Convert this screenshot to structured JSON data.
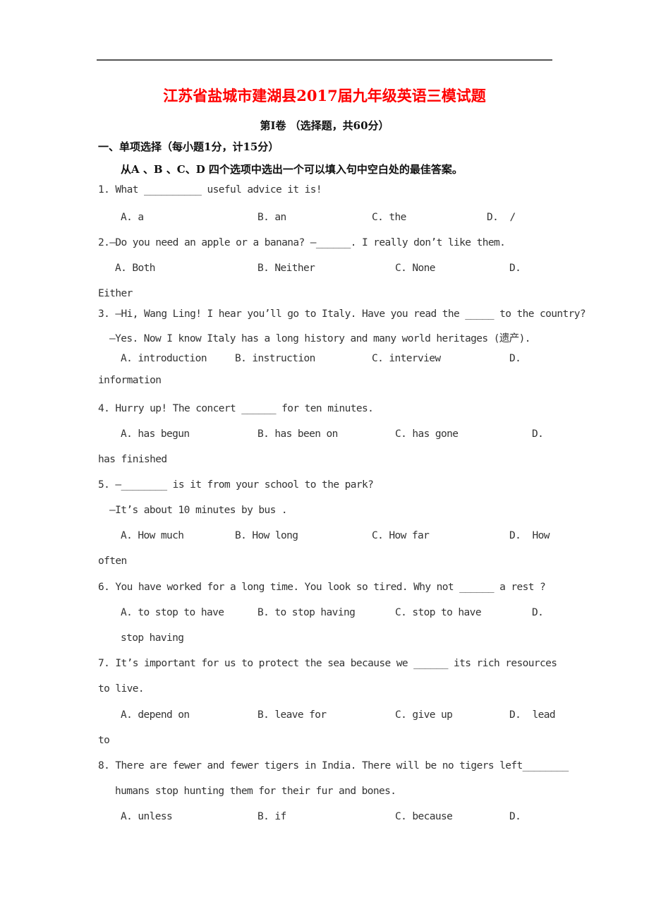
{
  "document": {
    "title": "江苏省盐城市建湖县2017届九年级英语三模试题",
    "part_heading": "第Ⅰ卷 （选择题，共60分）",
    "section_heading": "一、单项选择（每小题1分，计15分）",
    "instructions": "从A 、B 、C、D 四个选项中选出一个可以填入句中空白处的最佳答案。",
    "questions": [
      {
        "lines": [
          "1. What __________ useful advice it is!"
        ],
        "options": [
          "A. a",
          "B. an",
          "C. the",
          "D.  /"
        ],
        "overflow": ""
      },
      {
        "lines": [
          "2.—Do you need an apple or a banana? —______. I really don’t like them."
        ],
        "options": [
          "A. Both",
          "B. Neither",
          "C. None",
          "D."
        ],
        "overflow": "Either"
      },
      {
        "lines": [
          "3. —Hi, Wang Ling! I hear you’ll go to Italy. Have you read the _____ to the country?",
          "—Yes. Now I know Italy has a long history and many world heritages (遗产)."
        ],
        "options": [
          "A. introduction",
          "B. instruction",
          "C. interview",
          "D."
        ],
        "overflow": "information"
      },
      {
        "lines": [
          "4. Hurry up! The concert ______ for ten minutes."
        ],
        "options": [
          "A. has begun",
          "B. has been on",
          "C. has gone",
          "D."
        ],
        "overflow": "has finished"
      },
      {
        "lines": [
          "5. —________ is it from your school to the park?",
          "—It’s about 10 minutes by bus ."
        ],
        "options": [
          "A. How much",
          "B. How long",
          "C. How far",
          "D.  How"
        ],
        "overflow": "often"
      },
      {
        "lines": [
          "6. You have worked for a long time. You look so tired. Why not ______ a rest ?"
        ],
        "options": [
          "A. to stop to have",
          "B. to stop having",
          "C. stop to have",
          "D."
        ],
        "overflow": "stop having"
      },
      {
        "lines": [
          "7. It’s important for us to protect the sea because we ______ its rich resources",
          "to live."
        ],
        "options": [
          "A. depend on",
          "B. leave for",
          "C. give up",
          "D.  lead"
        ],
        "overflow": "to"
      },
      {
        "lines": [
          "8. There are fewer and fewer tigers in India. There will be no tigers left________",
          "humans stop hunting them for their fur and bones."
        ],
        "options": [
          "A. unless",
          "B. if",
          "C. because",
          "D."
        ],
        "overflow": ""
      }
    ]
  }
}
